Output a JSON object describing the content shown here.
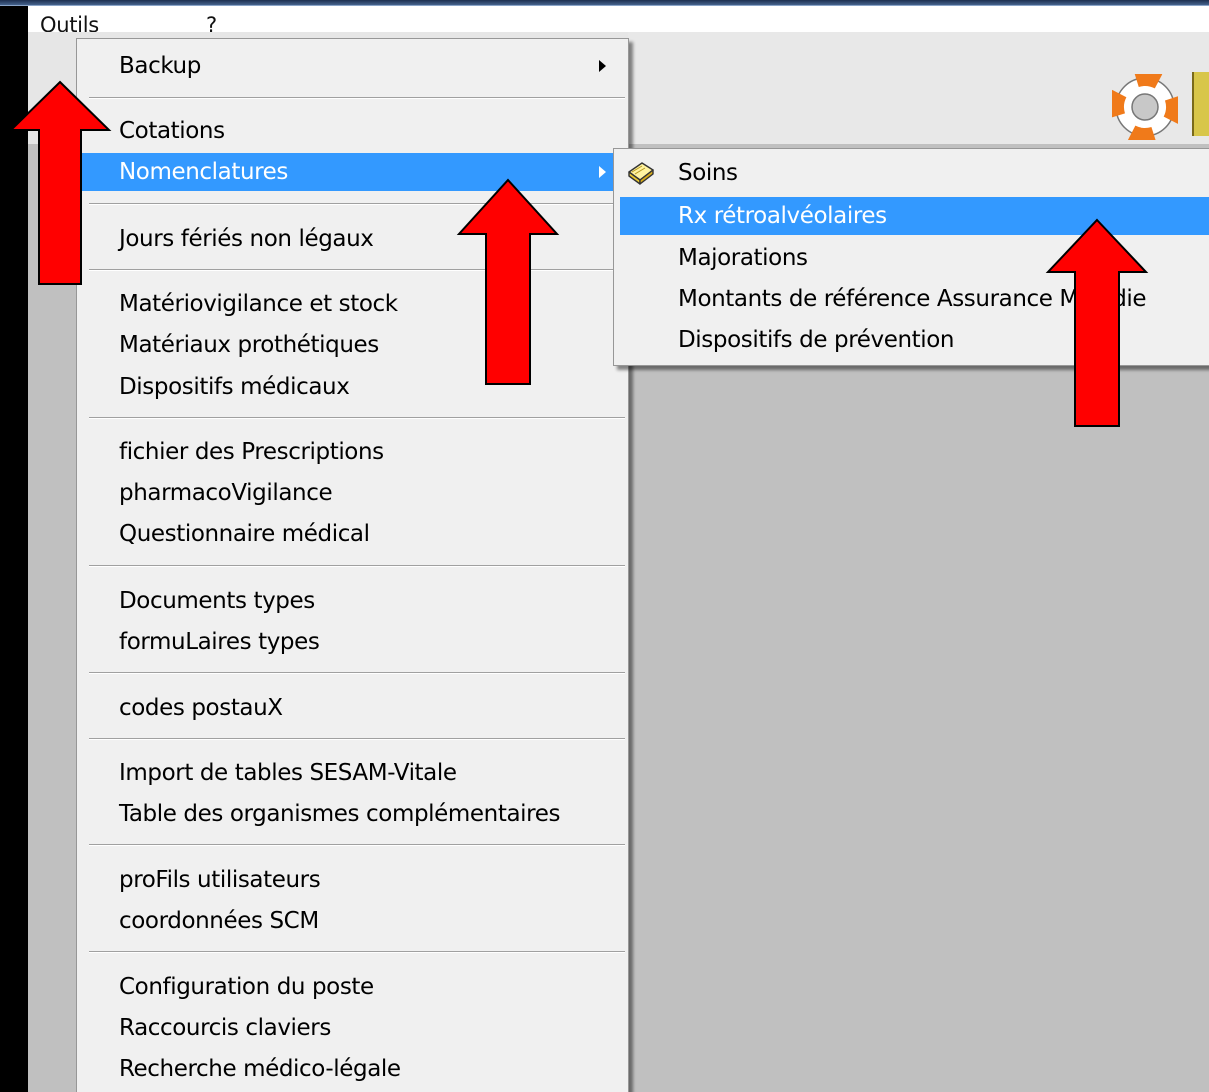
{
  "menubar": {
    "items": [
      {
        "label": "Outils"
      },
      {
        "label": "?"
      }
    ]
  },
  "tools_menu": {
    "items": [
      {
        "label": "Backup",
        "has_submenu": true
      },
      {
        "label": "Cotations"
      },
      {
        "label": "Nomenclatures",
        "has_submenu": true,
        "selected": true
      },
      {
        "label": "Jours fériés non légaux"
      },
      {
        "label": "Matériovigilance et stock"
      },
      {
        "label": "Matériaux prothétiques"
      },
      {
        "label": "Dispositifs médicaux"
      },
      {
        "label": "fichier des Prescriptions"
      },
      {
        "label": "pharmacoVigilance"
      },
      {
        "label": "Questionnaire médical"
      },
      {
        "label": "Documents types"
      },
      {
        "label": "formuLaires types"
      },
      {
        "label": "codes postauX"
      },
      {
        "label": "Import de tables SESAM-Vitale"
      },
      {
        "label": "Table des organismes complémentaires"
      },
      {
        "label": "proFils utilisateurs"
      },
      {
        "label": "coordonnées SCM"
      },
      {
        "label": "Configuration du poste"
      },
      {
        "label": "Raccourcis claviers"
      },
      {
        "label": "Recherche médico-légale"
      }
    ]
  },
  "nomenclatures_submenu": {
    "items": [
      {
        "label": "Soins",
        "icon": "book-icon"
      },
      {
        "label": "Rx rétroalvéolaires",
        "selected": true
      },
      {
        "label": "Majorations"
      },
      {
        "label": "Montants de référence Assurance Maladie"
      },
      {
        "label": "Dispositifs de prévention"
      }
    ]
  },
  "colors": {
    "selection": "#3399ff",
    "menu_bg": "#f0f0f0",
    "workspace": "#c0c0c0",
    "annotation_arrow": "#ff0000"
  }
}
